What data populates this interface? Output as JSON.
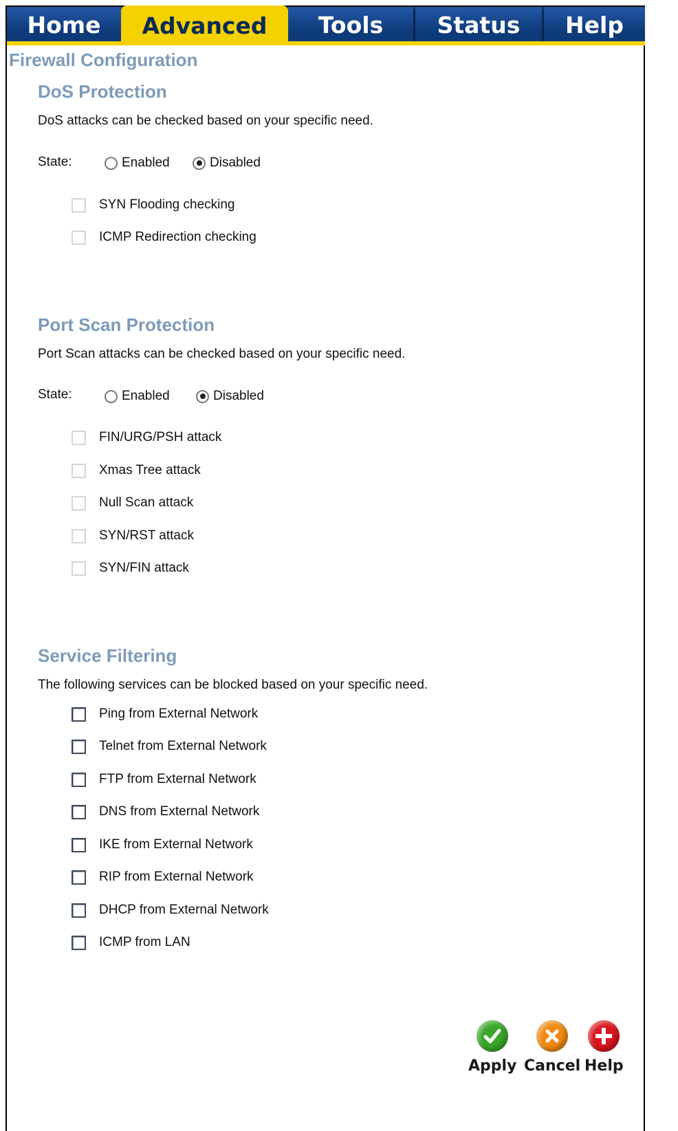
{
  "tabs": [
    {
      "label": "Home"
    },
    {
      "label": "Advanced"
    },
    {
      "label": "Tools"
    },
    {
      "label": "Status"
    },
    {
      "label": "Help"
    }
  ],
  "active_tab": "Advanced",
  "page_title": "Firewall Configuration",
  "dos": {
    "title": "DoS Protection",
    "description": "DoS attacks can be checked based on your specific need.",
    "state_label": "State:",
    "options": [
      "Enabled",
      "Disabled"
    ],
    "selected": "Disabled",
    "checks": [
      {
        "label": "SYN Flooding checking",
        "checked": false
      },
      {
        "label": "ICMP Redirection checking",
        "checked": false
      }
    ]
  },
  "portscan": {
    "title": "Port Scan Protection",
    "description": "Port Scan attacks can be checked based on your specific need.",
    "state_label": "State:",
    "options": [
      "Enabled",
      "Disabled"
    ],
    "selected": "Disabled",
    "checks": [
      {
        "label": "FIN/URG/PSH attack",
        "checked": false
      },
      {
        "label": "Xmas Tree attack",
        "checked": false
      },
      {
        "label": "Null Scan attack",
        "checked": false
      },
      {
        "label": "SYN/RST attack",
        "checked": false
      },
      {
        "label": "SYN/FIN attack",
        "checked": false
      }
    ]
  },
  "service": {
    "title": "Service Filtering",
    "description": "The following services can be blocked based on your specific need.",
    "checks": [
      {
        "label": "Ping from External Network",
        "checked": false
      },
      {
        "label": "Telnet from External Network",
        "checked": false
      },
      {
        "label": "FTP from External Network",
        "checked": false
      },
      {
        "label": "DNS from External Network",
        "checked": false
      },
      {
        "label": "IKE from External Network",
        "checked": false
      },
      {
        "label": "RIP from External Network",
        "checked": false
      },
      {
        "label": "DHCP from External Network",
        "checked": false
      },
      {
        "label": "ICMP from LAN",
        "checked": false
      }
    ]
  },
  "actions": {
    "apply": {
      "label": "Apply",
      "icon": "check-icon",
      "color": "#3aa52a"
    },
    "cancel": {
      "label": "Cancel",
      "icon": "x-icon",
      "color": "#f08a12"
    },
    "help": {
      "label": "Help",
      "icon": "plus-icon",
      "color": "#d9171e"
    }
  },
  "colors": {
    "tab_bar": "#0d3a78",
    "tab_active": "#f3d200",
    "heading": "#7d9bb8"
  }
}
